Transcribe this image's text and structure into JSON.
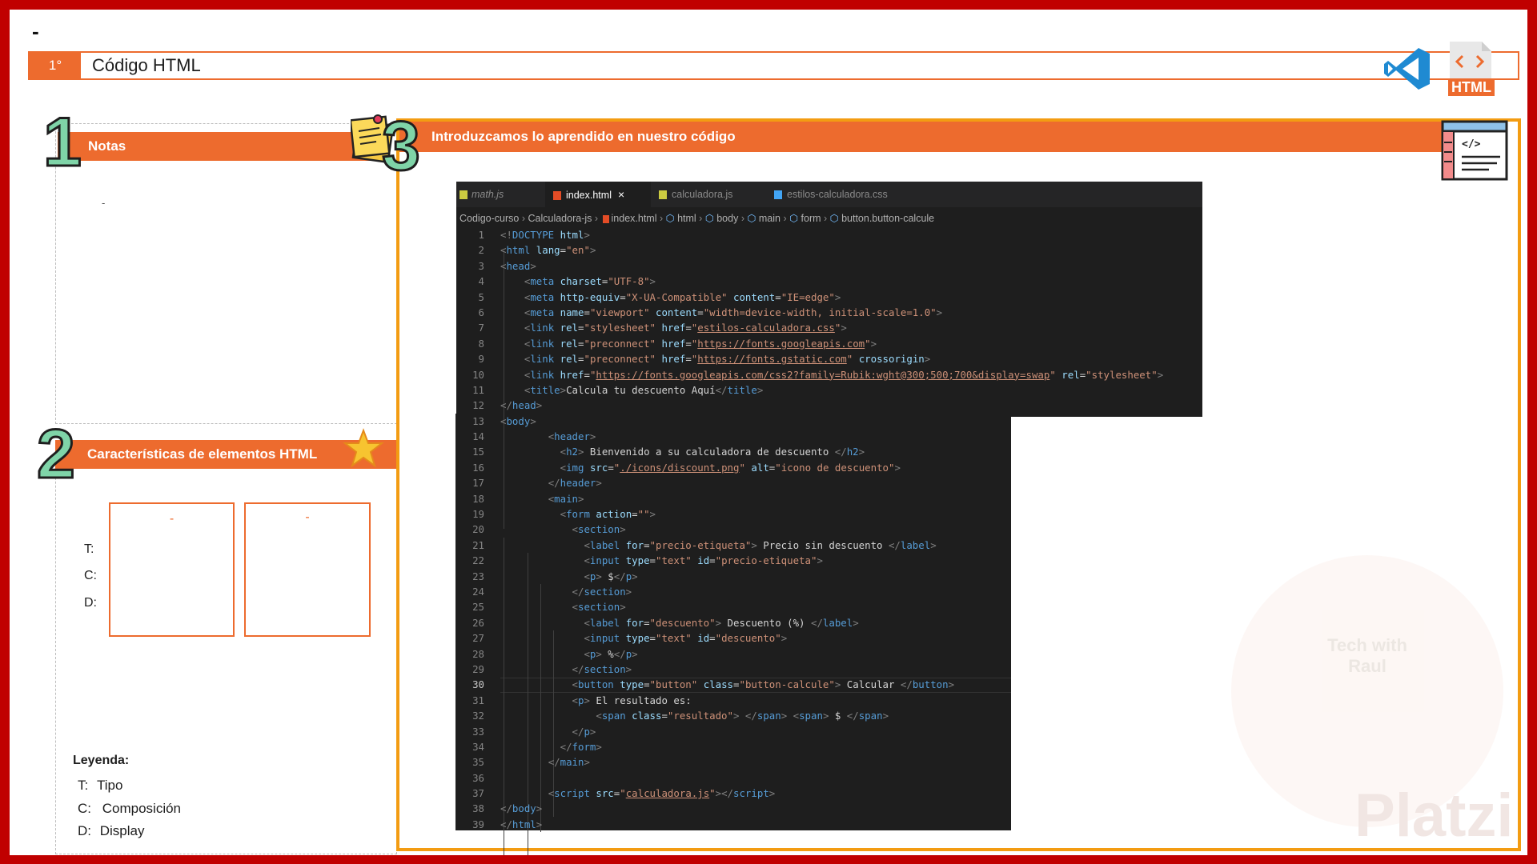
{
  "page": {
    "dash": "-",
    "step_badge": "1°",
    "title": "Código HTML"
  },
  "vscode_logo_icon": "vscode-logo-icon",
  "html_badge": {
    "label": "HTML"
  },
  "notes": {
    "number": "1",
    "header": "Notas",
    "placeholder": "-"
  },
  "features": {
    "number": "2",
    "header": "Características de elementos HTML",
    "labels": [
      "T:",
      "C:",
      "D:"
    ],
    "box1_dash": "-",
    "box2_dash": "-"
  },
  "legend": {
    "title": "Leyenda:",
    "items": [
      {
        "key": "T:",
        "value": "Tipo"
      },
      {
        "key": "C:",
        "value": "Composición"
      },
      {
        "key": "D:",
        "value": "Display"
      }
    ]
  },
  "practice": {
    "number": "3",
    "header": "Introduzcamos lo aprendido en nuestro código"
  },
  "editor": {
    "tabs": [
      {
        "label": "math.js",
        "icon": "js-icon",
        "active": false
      },
      {
        "label": "index.html",
        "icon": "html5-icon",
        "active": true,
        "close": "×"
      },
      {
        "label": "calculadora.js",
        "icon": "js-icon",
        "active": false
      },
      {
        "label": "estilos-calculadora.css",
        "icon": "css-icon",
        "active": false
      }
    ],
    "breadcrumb": [
      "Codigo-curso",
      "Calculadora-js",
      "index.html",
      "html",
      "body",
      "main",
      "form",
      "button.button-calcule"
    ],
    "current_line": "30"
  },
  "watermark": {
    "text1": "Tech with",
    "text2": "Raul",
    "brand": "Platzi"
  },
  "colors": {
    "accent": "#ed6b2e",
    "border": "#c00000",
    "editor_bg": "#1e1e1e",
    "number_fill": "#7fd4a8"
  }
}
